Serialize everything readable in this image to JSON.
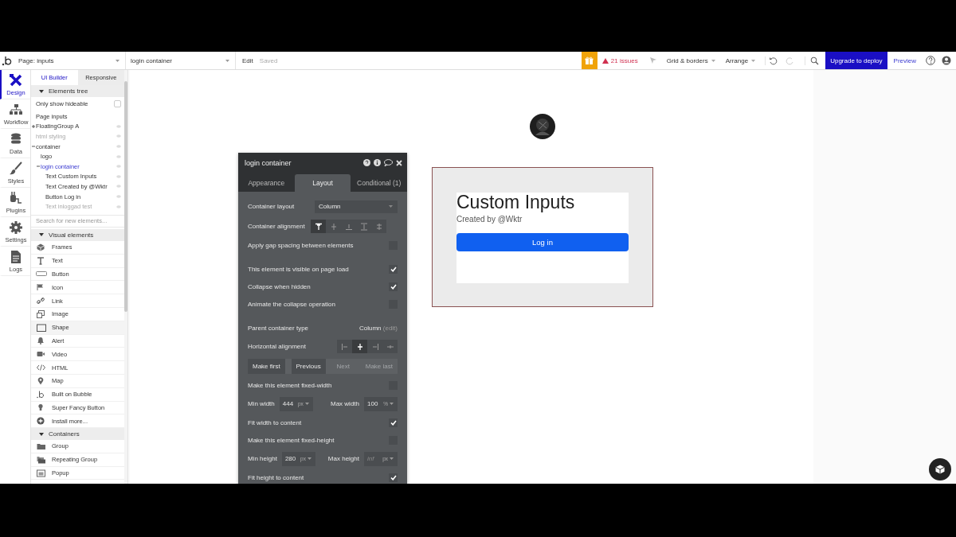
{
  "topbar": {
    "page_select": "Page: inputs",
    "element_select": "login container",
    "edit": "Edit",
    "saved": "Saved",
    "issues": "21 issues",
    "grid_menu": "Grid & borders",
    "arrange_menu": "Arrange",
    "upgrade_button": "Upgrade to deploy",
    "preview": "Preview"
  },
  "rail": [
    {
      "label": "Design",
      "selected": true
    },
    {
      "label": "Workflow",
      "selected": false
    },
    {
      "label": "Data",
      "selected": false
    },
    {
      "label": "Styles",
      "selected": false
    },
    {
      "label": "Plugins",
      "selected": false
    },
    {
      "label": "Settings",
      "selected": false
    },
    {
      "label": "Logs",
      "selected": false
    }
  ],
  "sidebar": {
    "tabs": [
      {
        "label": "UI Builder",
        "selected": true
      },
      {
        "label": "Responsive",
        "selected": false
      }
    ],
    "tree_header": "Elements tree",
    "only_show_hideable": {
      "label": "Only show hideable",
      "checked": false
    },
    "tree": [
      {
        "label": "Page inputs",
        "selected": false,
        "dimmed": false
      },
      {
        "label": "FloatingGroup A",
        "selected": false,
        "dimmed": false,
        "expanded": false
      },
      {
        "label": "html styling",
        "selected": false,
        "dimmed": true
      },
      {
        "label": "container",
        "selected": false,
        "dimmed": false,
        "expanded": true,
        "children": [
          {
            "label": "logo",
            "selected": false,
            "dimmed": false
          },
          {
            "label": "login container",
            "selected": true,
            "dimmed": false,
            "expanded": true,
            "children": [
              {
                "label": "Text Custom Inputs",
                "selected": false,
                "dimmed": false
              },
              {
                "label": "Text Created by @Wktr",
                "selected": false,
                "dimmed": false
              },
              {
                "label": "Button Log in",
                "selected": false,
                "dimmed": false
              },
              {
                "label": "Text inloggad test",
                "selected": false,
                "dimmed": true
              }
            ]
          }
        ]
      }
    ],
    "search": {
      "placeholder": "Search for new elements..."
    },
    "sections": [
      {
        "title": "Visual elements",
        "expanded": true,
        "items": [
          {
            "label": "Frames",
            "hovered": false
          },
          {
            "label": "Text",
            "hovered": false
          },
          {
            "label": "Button",
            "hovered": false
          },
          {
            "label": "Icon",
            "hovered": false
          },
          {
            "label": "Link",
            "hovered": false
          },
          {
            "label": "Image",
            "hovered": false
          },
          {
            "label": "Shape",
            "hovered": true
          },
          {
            "label": "Alert",
            "hovered": false
          },
          {
            "label": "Video",
            "hovered": false
          },
          {
            "label": "HTML",
            "hovered": false
          },
          {
            "label": "Map",
            "hovered": false
          },
          {
            "label": "Built on Bubble",
            "hovered": false
          },
          {
            "label": "Super Fancy Button",
            "hovered": false
          },
          {
            "label": "Install more...",
            "hovered": false
          }
        ]
      },
      {
        "title": "Containers",
        "expanded": true,
        "items": [
          {
            "label": "Group",
            "hovered": false
          },
          {
            "label": "Repeating Group",
            "hovered": false
          },
          {
            "label": "Popup",
            "hovered": false
          }
        ]
      }
    ]
  },
  "canvas": {
    "login_container": {
      "title": "Custom Inputs",
      "subtitle": "Created by @Wktr",
      "button": "Log in"
    }
  },
  "properties": {
    "title": "login container",
    "tabs": [
      {
        "label": "Appearance",
        "selected": false
      },
      {
        "label": "Layout",
        "selected": true
      },
      {
        "label": "Conditional (1)",
        "selected": false
      }
    ],
    "groups": [
      [
        {
          "kind": "dropdown",
          "label": "Container layout",
          "value": "Column"
        },
        {
          "kind": "segmented",
          "label": "Container alignment",
          "options": [
            {
              "selected": true
            },
            {
              "selected": false
            },
            {
              "selected": false
            },
            {
              "selected": false
            },
            {
              "selected": false
            }
          ]
        },
        {
          "kind": "checkbox",
          "label": "Apply gap spacing between elements",
          "checked": false
        }
      ],
      [
        {
          "kind": "checkbox",
          "label": "This element is visible on page load",
          "checked": true
        },
        {
          "kind": "checkbox",
          "label": "Collapse when hidden",
          "checked": true
        },
        {
          "kind": "checkbox",
          "label": "Animate the collapse operation",
          "checked": false
        }
      ],
      [
        {
          "kind": "info",
          "label": "Parent container type",
          "value": "Column",
          "link": "(edit)"
        },
        {
          "kind": "segmented",
          "label": "Horizontal alignment",
          "options": [
            {
              "selected": false
            },
            {
              "selected": true
            },
            {
              "selected": false
            },
            {
              "selected": false
            }
          ]
        },
        {
          "kind": "buttons",
          "buttons": [
            {
              "label": "Make first",
              "disabled": false
            },
            {
              "label": "Previous",
              "disabled": false
            },
            {
              "label": "Next",
              "disabled": true
            },
            {
              "label": "Make last",
              "disabled": true
            }
          ]
        },
        {
          "kind": "checkbox",
          "label": "Make this element fixed-width",
          "checked": false
        },
        {
          "kind": "pair",
          "fields": [
            {
              "label": "Min width",
              "value": "444",
              "unit": "px"
            },
            {
              "label": "Max width",
              "value": "100",
              "unit": "%"
            }
          ]
        },
        {
          "kind": "checkbox",
          "label": "Fit width to content",
          "checked": true
        },
        {
          "kind": "checkbox",
          "label": "Make this element fixed-height",
          "checked": false
        },
        {
          "kind": "pair",
          "fields": [
            {
              "label": "Min height",
              "value": "280",
              "unit": "px"
            },
            {
              "label": "Max height",
              "placeholder": "inf",
              "unit": "px"
            }
          ]
        },
        {
          "kind": "checkbox",
          "label": "Fit height to content",
          "checked": true
        }
      ]
    ]
  }
}
